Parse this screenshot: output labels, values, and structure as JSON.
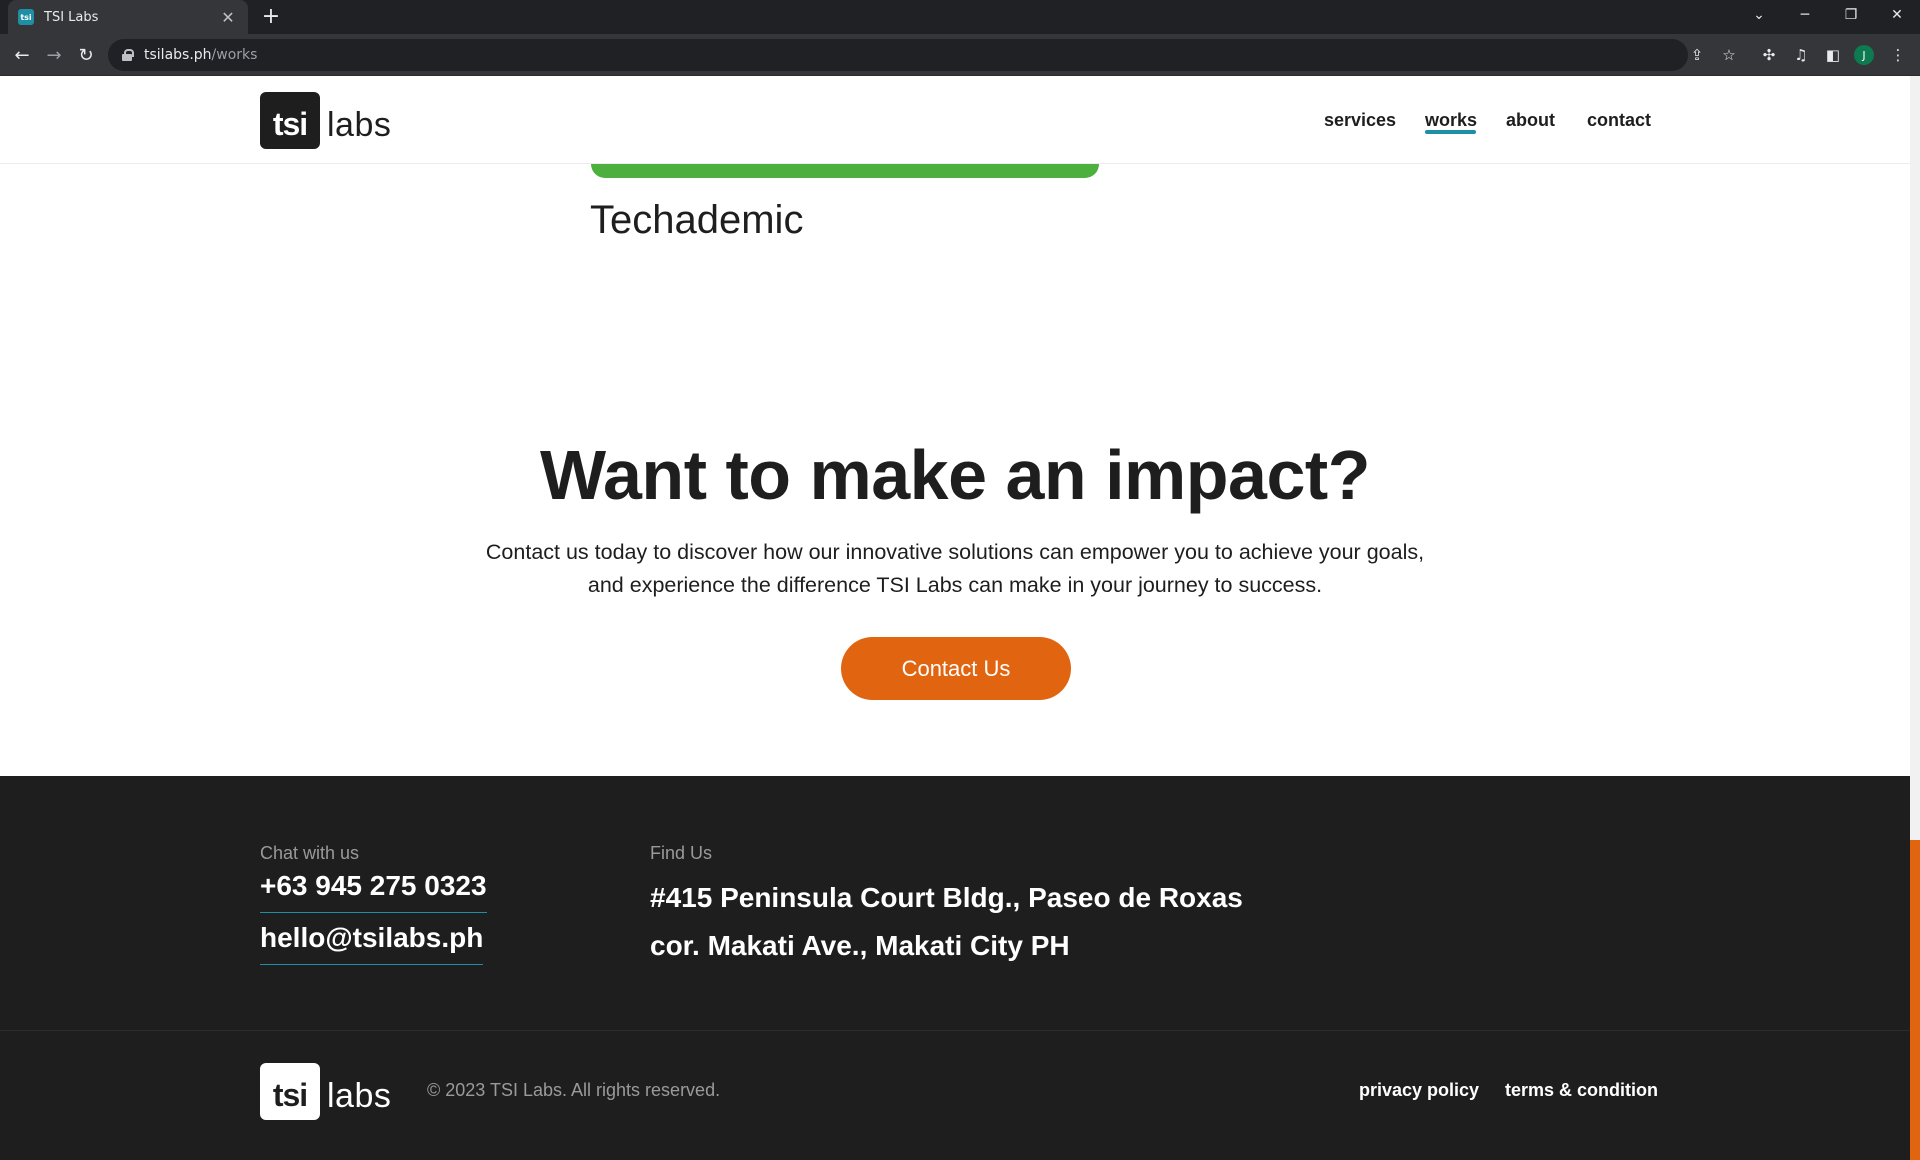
{
  "browser": {
    "tab_title": "TSI Labs",
    "favicon_text": "tsi",
    "tab_close": "✕",
    "new_tab": "+",
    "url_host": "tsilabs.ph",
    "url_path": "/works",
    "profile_initial": "J"
  },
  "header": {
    "logo_mark": "tsi",
    "logo_word": "labs",
    "nav": [
      {
        "label": "services"
      },
      {
        "label": "works",
        "active": true
      },
      {
        "label": "about"
      },
      {
        "label": "contact"
      }
    ]
  },
  "project": {
    "title": "Techademic",
    "accent_color": "#4caf3e"
  },
  "cta": {
    "heading": "Want to make an impact?",
    "text_line1": "Contact us today to discover how our innovative solutions can empower you to achieve your goals,",
    "text_line2": "and experience the difference TSI Labs can make in your journey to success.",
    "button_label": "Contact Us",
    "button_color": "#e16511"
  },
  "footer": {
    "chat_label": "Chat with us",
    "phone": "+63 945 275 0323",
    "email": "hello@tsilabs.ph",
    "find_label": "Find Us",
    "address_line1": "#415 Peninsula Court Bldg., Paseo de Roxas",
    "address_line2": "cor. Makati Ave., Makati City PH",
    "copyright": "© 2023 TSI Labs. All rights reserved.",
    "links": [
      {
        "label": "privacy policy"
      },
      {
        "label": "terms & condition"
      }
    ],
    "link_accent": "#1e8fa6"
  }
}
